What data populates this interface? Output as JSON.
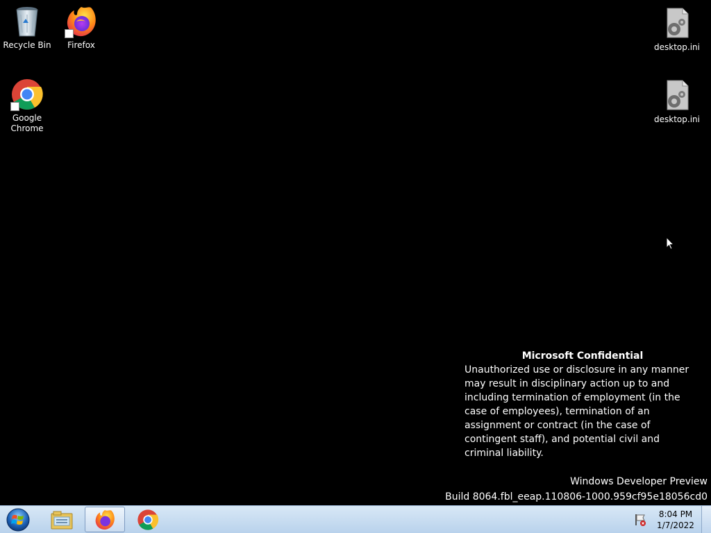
{
  "desktop": {
    "icons": [
      {
        "label": "Recycle Bin",
        "icon": "recycle-bin-icon"
      },
      {
        "label": "Firefox",
        "icon": "firefox-icon"
      },
      {
        "label": "Google Chrome",
        "icon": "chrome-icon"
      },
      {
        "label": "desktop.ini",
        "icon": "settings-file-icon"
      },
      {
        "label": "desktop.ini",
        "icon": "settings-file-icon"
      }
    ]
  },
  "confidential": {
    "title": "Microsoft Confidential",
    "body": "Unauthorized use or disclosure in any manner may result in disciplinary action up to and including termination of employment (in the case of employees), termination of an assignment or contract (in the case of contingent staff), and potential civil and criminal liability."
  },
  "watermark": {
    "line1": "Windows Developer Preview",
    "line2": "Build 8064.fbl_eeap.110806-1000.959cf95e18056cd0"
  },
  "taskbar": {
    "buttons": [
      {
        "icon": "start-orb-icon"
      },
      {
        "icon": "windows-explorer-icon"
      },
      {
        "icon": "firefox-icon",
        "active": true
      },
      {
        "icon": "chrome-icon"
      }
    ],
    "tray": {
      "icon": "action-center-flag-icon"
    },
    "clock": {
      "time": "8:04 PM",
      "date": "1/7/2022"
    }
  },
  "colors": {
    "desktop_bg": "#000000",
    "taskbar_bg": "#c8dcf0",
    "text": "#ffffff"
  }
}
